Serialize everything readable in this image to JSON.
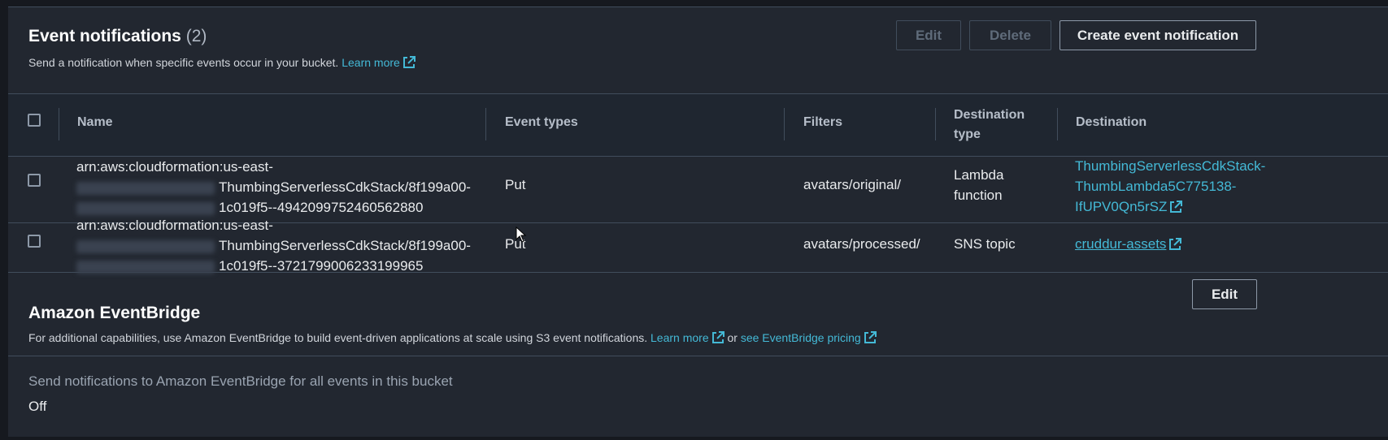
{
  "event_notifications": {
    "title": "Event notifications",
    "count": "(2)",
    "description": "Send a notification when specific events occur in your bucket.",
    "learn_more": "Learn more",
    "buttons": {
      "edit": "Edit",
      "delete": "Delete",
      "create": "Create event notification"
    },
    "columns": {
      "name": "Name",
      "event_types": "Event types",
      "filters": "Filters",
      "destination_type_line1": "Destination",
      "destination_type_line2": "type",
      "destination": "Destination"
    },
    "rows": [
      {
        "name_line1": "arn:aws:cloudformation:us-east-",
        "name_line2": "ThumbingServerlessCdkStack/8f199a00-",
        "name_line3": "1c019f5--4942099752460562880",
        "event_types": "Put",
        "filters": "avatars/original/",
        "destination_type_line1": "Lambda",
        "destination_type_line2": "function",
        "destination_line1": "ThumbingServerlessCdkStack-",
        "destination_line2": "ThumbLambda5C775138-",
        "destination_line3": "IfUPV0Qn5rSZ"
      },
      {
        "name_line1": "arn:aws:cloudformation:us-east-",
        "name_line2": "ThumbingServerlessCdkStack/8f199a00-",
        "name_line3": "1c019f5--3721799006233199965",
        "event_types": "Put",
        "filters": "avatars/processed/",
        "destination_type": "SNS topic",
        "destination": "cruddur-assets"
      }
    ]
  },
  "eventbridge": {
    "title": "Amazon EventBridge",
    "description": "For additional capabilities, use Amazon EventBridge to build event-driven applications at scale using S3 event notifications.",
    "learn_more": "Learn more",
    "or_text": "or",
    "pricing_link": "see EventBridge pricing",
    "edit_button": "Edit",
    "setting_label": "Send notifications to Amazon EventBridge for all events in this bucket",
    "setting_value": "Off"
  },
  "colors": {
    "link": "#44b9d6",
    "background": "#222730"
  }
}
